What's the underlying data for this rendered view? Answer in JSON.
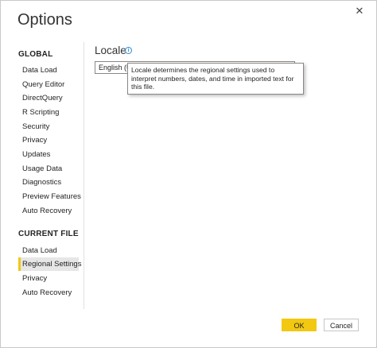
{
  "window": {
    "title": "Options",
    "close_glyph": "✕"
  },
  "sidebar": {
    "global_heading": "GLOBAL",
    "global_items": [
      {
        "label": "Data Load"
      },
      {
        "label": "Query Editor"
      },
      {
        "label": "DirectQuery"
      },
      {
        "label": "R Scripting"
      },
      {
        "label": "Security"
      },
      {
        "label": "Privacy"
      },
      {
        "label": "Updates"
      },
      {
        "label": "Usage Data"
      },
      {
        "label": "Diagnostics"
      },
      {
        "label": "Preview Features"
      },
      {
        "label": "Auto Recovery"
      }
    ],
    "current_file_heading": "CURRENT FILE",
    "current_file_items": [
      {
        "label": "Data Load"
      },
      {
        "label": "Regional Settings",
        "selected": true
      },
      {
        "label": "Privacy"
      },
      {
        "label": "Auto Recovery"
      }
    ]
  },
  "main": {
    "heading": "Locale",
    "info_glyph": "i",
    "locale_value": "English (U",
    "tooltip": "Locale determines the regional settings used to interpret numbers, dates, and time in imported text for this file."
  },
  "footer": {
    "ok_label": "OK",
    "cancel_label": "Cancel"
  },
  "colors": {
    "accent": "#f2c811",
    "selected_bg": "#e6e6e6",
    "info_blue": "#2b88d8"
  }
}
